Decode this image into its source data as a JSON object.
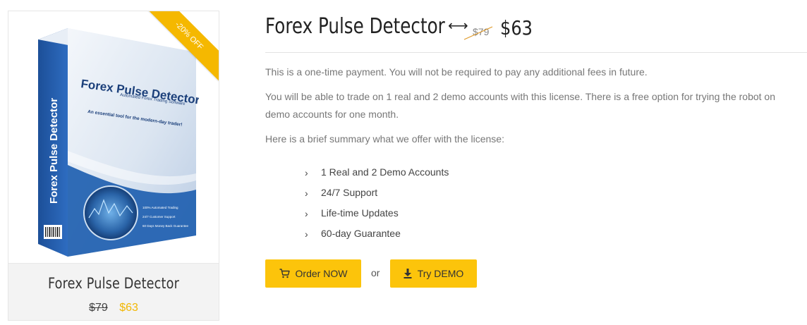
{
  "card": {
    "ribbon": "-20% OFF",
    "title": "Forex Pulse Detector",
    "old_price": "$79",
    "new_price": "$63",
    "box_art": {
      "title": "Forex Pulse Detector",
      "subtitle": "Automated Forex Trading Software",
      "tagline": "An essential tool for the modern-day trader!",
      "spine": "Forex Pulse Detector",
      "bullets": [
        "100% Automated Trading",
        "24/7 Customer Support",
        "60 Days Money Back Guarantee"
      ]
    }
  },
  "product": {
    "title": "Forex Pulse Detector",
    "arrow": "⟷",
    "old_price": "$79",
    "new_price": "$63"
  },
  "description": {
    "p1": "This is a one-time payment. You will not be required to pay any additional fees in future.",
    "p2": "You will be able to trade on 1 real and 2 demo accounts with this license. There is a free option for trying the robot on demo accounts for one month.",
    "p3": "Here is a brief summary what we offer with the license:"
  },
  "features": [
    {
      "label": "1 Real and 2 Demo Accounts"
    },
    {
      "label": "24/7 Support"
    },
    {
      "label": "Life-time Updates"
    },
    {
      "label": "60-day Guarantee"
    }
  ],
  "actions": {
    "order_label": "Order NOW",
    "or_label": "or",
    "demo_label": "Try DEMO"
  },
  "colors": {
    "accent": "#fcc40b",
    "ribbon": "#f5b800",
    "sale_price": "#f2b705",
    "box_blue": "#1f5fb0"
  },
  "icons": {
    "chevron": "chevron-right-icon",
    "order": "cart-icon",
    "demo": "download-icon"
  }
}
